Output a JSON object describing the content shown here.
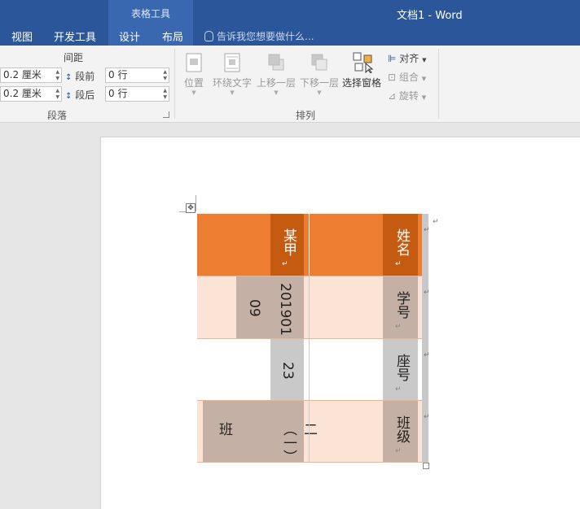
{
  "window": {
    "title": "文档1 - Word",
    "context_group": "表格工具"
  },
  "tabs": [
    "视图",
    "开发工具",
    "设计",
    "布局"
  ],
  "tellme": {
    "placeholder": "告诉我您想要做什么..."
  },
  "paragraph_group": {
    "spacing_heading": "间距",
    "indent_left": "0.2 厘米",
    "indent_right": "0.2 厘米",
    "before_label": "段前",
    "before_value": "0 行",
    "after_label": "段后",
    "after_value": "0 行",
    "group_label": "段落"
  },
  "arrange_group": {
    "position": "位置",
    "wrap_text": "环绕文字",
    "bring_forward": "上移一层",
    "send_backward": "下移一层",
    "selection_pane": "选择窗格",
    "align": "对齐",
    "group": "组合",
    "rotate": "旋转",
    "group_label": "排列"
  },
  "table": {
    "rows": [
      {
        "label": "姓名",
        "value": "某甲",
        "value_extra": ""
      },
      {
        "label": "学号",
        "value": "201901",
        "value_extra": "09"
      },
      {
        "label": "座号",
        "value": "23",
        "value_extra": ""
      },
      {
        "label": "班级",
        "value": "二（一）",
        "value_extra": "班"
      }
    ]
  },
  "colors": {
    "accent": "#2b579a",
    "header_fill": "#ed7d31",
    "light_fill": "#fbe4d5",
    "gray_fill": "#c9c9c9"
  }
}
